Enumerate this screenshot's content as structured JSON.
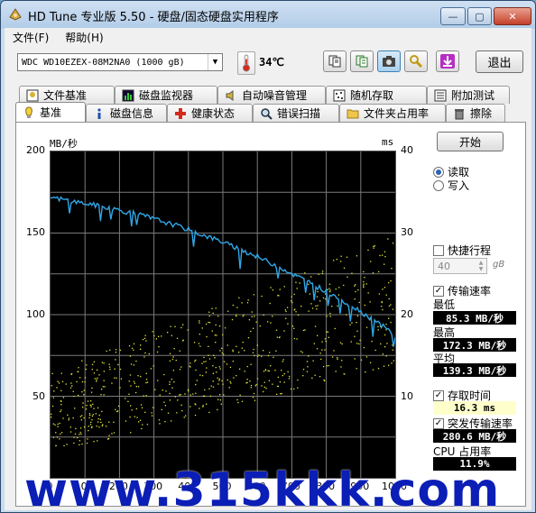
{
  "window": {
    "title": "HD Tune 专业版 5.50 - 硬盘/固态硬盘实用程序",
    "controls": {
      "minimize": "—",
      "maximize": "▢",
      "close": "✕"
    }
  },
  "menu": {
    "items": [
      "文件(F)",
      "帮助(H)"
    ]
  },
  "toolbar": {
    "drive": "WDC     WD10EZEX-08M2NA0  (1000 gB)",
    "temperature": "34℃",
    "icons": [
      "copy-info-icon",
      "copy-all-icon",
      "screenshot-icon",
      "options-icon",
      "save-download-icon"
    ],
    "exit_label": "退出"
  },
  "tabs": {
    "back_row": [
      {
        "label": "文件基准",
        "icon": "file-benchmark-icon"
      },
      {
        "label": "磁盘监视器",
        "icon": "disk-monitor-icon"
      },
      {
        "label": "自动噪音管理",
        "icon": "speaker-icon"
      },
      {
        "label": "随机存取",
        "icon": "random-access-icon"
      },
      {
        "label": "附加测试",
        "icon": "extra-tests-icon"
      }
    ],
    "front_row": [
      {
        "label": "基准",
        "icon": "benchmark-icon",
        "selected": true
      },
      {
        "label": "磁盘信息",
        "icon": "info-icon"
      },
      {
        "label": "健康状态",
        "icon": "health-cross-icon"
      },
      {
        "label": "错误扫描",
        "icon": "error-scan-icon"
      },
      {
        "label": "文件夹占用率",
        "icon": "folder-icon"
      },
      {
        "label": "擦除",
        "icon": "trash-icon"
      }
    ]
  },
  "chart_data": {
    "type": "line",
    "ylabel_left": "MB/秒",
    "ylabel_right": "ms",
    "ylim_left": [
      0,
      200
    ],
    "ylim_right": [
      0,
      40
    ],
    "yticks_left": [
      "200",
      "150",
      "100",
      "50"
    ],
    "yticks_right": [
      "40",
      "30",
      "20",
      "10"
    ],
    "xlim": [
      0,
      1000
    ],
    "xticks": [
      "0",
      "100",
      "200",
      "300",
      "400",
      "500",
      "600",
      "700",
      "800",
      "900",
      "1000"
    ],
    "grid": true,
    "series": [
      {
        "color": "#2fa6e6",
        "x": [
          0,
          20,
          40,
          60,
          80,
          100,
          120,
          140,
          160,
          180,
          200,
          220,
          240,
          260,
          280,
          300,
          320,
          340,
          360,
          380,
          400,
          420,
          440,
          460,
          480,
          500,
          520,
          540,
          560,
          580,
          600,
          620,
          640,
          660,
          680,
          700,
          720,
          740,
          760,
          780,
          800,
          820,
          840,
          860,
          880,
          900,
          920,
          940,
          960,
          980,
          1000
        ],
        "values": [
          172,
          171,
          170.5,
          169.5,
          169,
          168,
          167.5,
          166.5,
          165.5,
          165,
          164,
          163,
          162,
          161,
          160,
          158.5,
          157.5,
          156,
          155,
          153.5,
          152,
          150.5,
          149,
          147.5,
          146,
          144.5,
          142.5,
          141,
          139,
          137.5,
          135.5,
          133.5,
          131.5,
          129.5,
          127.5,
          125,
          123,
          121,
          118.5,
          116.5,
          114,
          112,
          109.5,
          107,
          104.5,
          102,
          99,
          96.5,
          93.5,
          90.5,
          86
        ]
      }
    ],
    "access_time_scatter": {
      "color": "#e8e83a",
      "y_range_ms": [
        4,
        30
      ]
    }
  },
  "controls": {
    "start_label": "开始",
    "read_label": "读取",
    "write_label": "写入",
    "quick_stroke_label": "快捷行程",
    "quick_stroke_value": "40",
    "quick_stroke_unit": "gB",
    "transfer_rate_label": "传输速率",
    "min_label": "最低",
    "min_value": "85.3 MB/秒",
    "max_label": "最高",
    "max_value": "172.3 MB/秒",
    "avg_label": "平均",
    "avg_value": "139.3 MB/秒",
    "access_time_label": "存取时间",
    "access_time_value": "16.3 ms",
    "burst_rate_label": "突发传输速率",
    "burst_rate_value": "280.6 MB/秒",
    "cpu_label": "CPU 占用率",
    "cpu_value": "11.9%"
  },
  "watermark": "www.315kkk.com"
}
